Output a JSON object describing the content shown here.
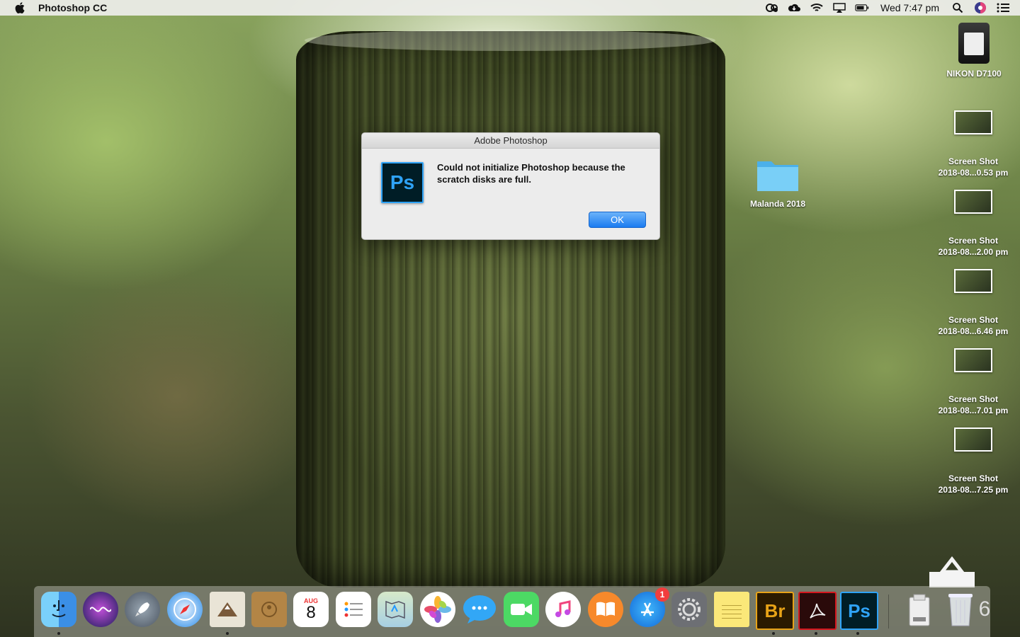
{
  "menubar": {
    "app_name": "Photoshop CC",
    "clock": "Wed 7:47 pm"
  },
  "dialog": {
    "title": "Adobe Photoshop",
    "icon_label": "Ps",
    "message": "Could not initialize Photoshop because the scratch disks are full.",
    "ok_label": "OK"
  },
  "desktop": {
    "drive": {
      "label": "NIKON D7100"
    },
    "folder": {
      "label": "Malanda 2018"
    },
    "screenshots": [
      {
        "line1": "Screen Shot",
        "line2": "2018-08...0.53 pm"
      },
      {
        "line1": "Screen Shot",
        "line2": "2018-08...2.00 pm"
      },
      {
        "line1": "Screen Shot",
        "line2": "2018-08...6.46 pm"
      },
      {
        "line1": "Screen Shot",
        "line2": "2018-08...7.01 pm"
      },
      {
        "line1": "Screen Shot",
        "line2": "2018-08...7.25 pm"
      }
    ]
  },
  "dock": {
    "calendar_month": "AUG",
    "calendar_day": "8",
    "appstore_badge": "1",
    "bridge_label": "Br",
    "photoshop_label": "Ps",
    "edge_glyph": "6"
  },
  "colors": {
    "accent": "#1a7bf0",
    "ps_blue": "#2fa3f7",
    "ps_bg": "#001d26",
    "bridge_orange": "#e8a317",
    "acrobat_red": "#d4171e",
    "folder_blue": "#63c5f5"
  }
}
